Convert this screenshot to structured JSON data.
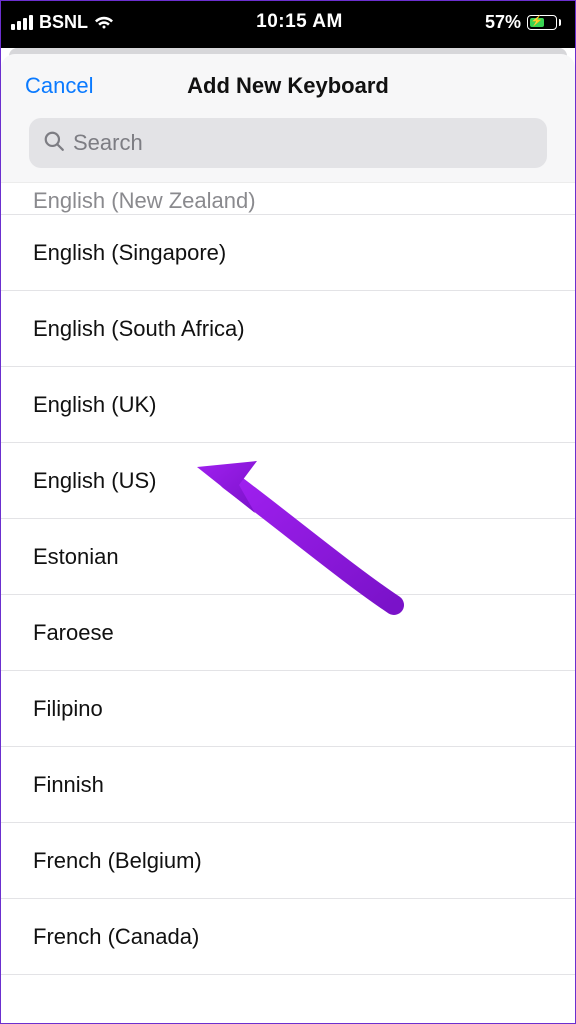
{
  "status": {
    "carrier": "BSNL",
    "time": "10:15 AM",
    "battery_pct": "57%"
  },
  "nav": {
    "cancel": "Cancel",
    "title": "Add New Keyboard"
  },
  "search": {
    "placeholder": "Search"
  },
  "list": {
    "clipped": "English (New Zealand)",
    "items": [
      "English (Singapore)",
      "English (South Africa)",
      "English (UK)",
      "English (US)",
      "Estonian",
      "Faroese",
      "Filipino",
      "Finnish",
      "French (Belgium)",
      "French (Canada)"
    ]
  },
  "annotation": {
    "arrow_color": "#a020f0"
  }
}
